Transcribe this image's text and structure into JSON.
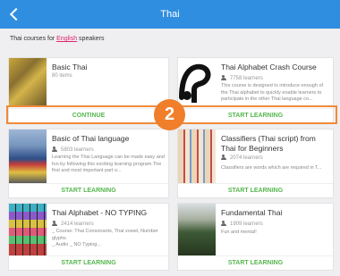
{
  "header": {
    "title": "Thai"
  },
  "subtitle": {
    "prefix": "Thai courses for ",
    "language": "English",
    "suffix": " speakers"
  },
  "courses": [
    {
      "title": "Basic Thai",
      "learners": "80 items",
      "description": "",
      "cta": "CONTINUE"
    },
    {
      "title": "Thai Alphabet Crash Course",
      "learners": "7758 learners",
      "description": "This course is designed to introduce enough of the Thai alphabet to quickly enable learners to participate in the other Thai language co...",
      "cta": "START LEARNING"
    },
    {
      "title": "Basic of Thai language",
      "learners": "5803 learners",
      "description": "Learning the Thai Language can be made easy and fun by following this exciting learning program.The first and most important part o...",
      "cta": "START LEARNING"
    },
    {
      "title": "Classifiers (Thai script) from Thai for Beginners",
      "learners": "2074 learners",
      "description": "Classifiers are words which are required in T...",
      "cta": "START LEARNING"
    },
    {
      "title": "Thai Alphabet - NO TYPING",
      "learners": "2414 learners",
      "description": "_ Course: Thai Consonants, Thai vowel, Number glyphs\n_ Audio _ NO Typing...",
      "cta": "START LEARNING"
    },
    {
      "title": "Fundamental Thai",
      "learners": "1909 learners",
      "description": "Fun and mental!",
      "cta": "START LEARNING"
    }
  ],
  "annotation": {
    "step": "2",
    "color": "#f07e2a"
  },
  "colors": {
    "header": "#2f8ee0",
    "accent_green": "#56b74e",
    "link_pink": "#e0216d"
  }
}
